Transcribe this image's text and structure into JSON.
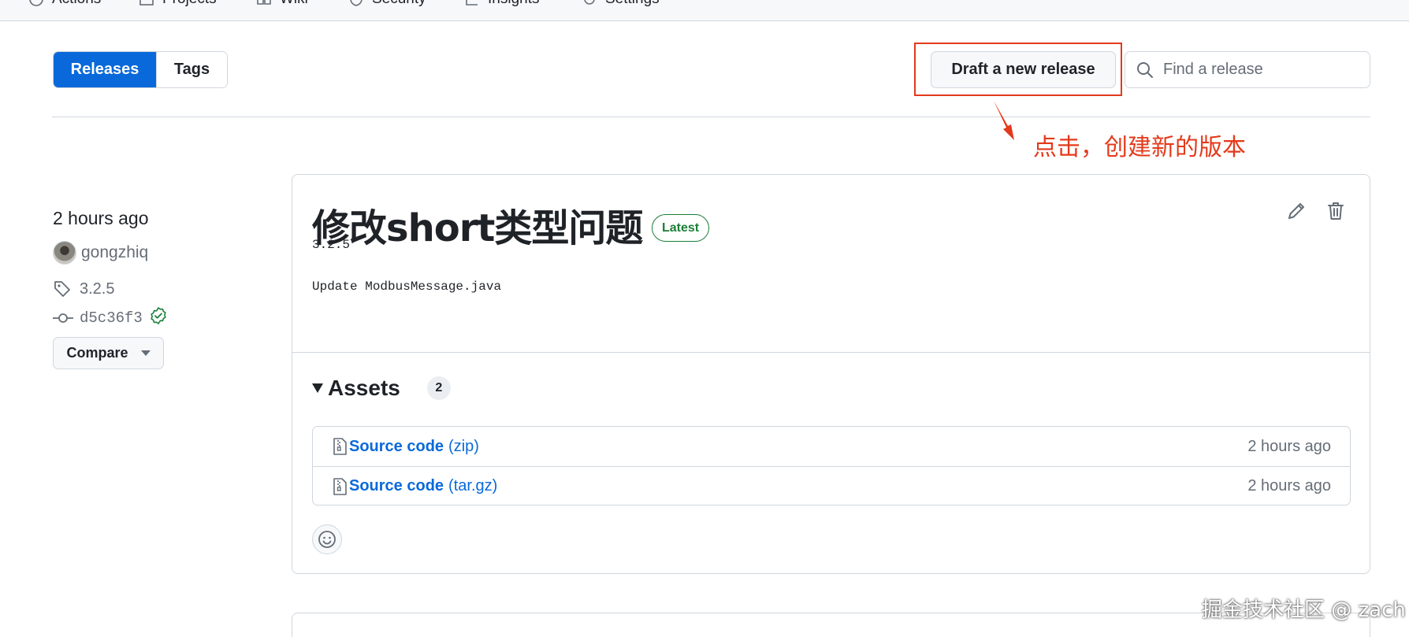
{
  "top_nav": {
    "items": [
      {
        "label": "Actions",
        "icon": "play-icon"
      },
      {
        "label": "Projects",
        "icon": "table-icon"
      },
      {
        "label": "Wiki",
        "icon": "book-icon"
      },
      {
        "label": "Security",
        "icon": "shield-icon"
      },
      {
        "label": "Insights",
        "icon": "graph-icon"
      },
      {
        "label": "Settings",
        "icon": "gear-icon"
      }
    ]
  },
  "toolbar": {
    "releases_label": "Releases",
    "tags_label": "Tags",
    "draft_label": "Draft a new release",
    "search_placeholder": "Find a release"
  },
  "annotation": {
    "text": "点击，创建新的版本",
    "color": "#e4391b"
  },
  "release": {
    "time_ago": "2 hours ago",
    "author": "gongzhiq",
    "tag": "3.2.5",
    "commit": "d5c36f3",
    "compare_label": "Compare",
    "title": "修改short类型问题",
    "badge": "Latest",
    "body_lines": [
      "3.2.5",
      "Update ModbusMessage.java"
    ],
    "assets_label": "Assets",
    "assets_count": "2",
    "assets": [
      {
        "name": "Source code",
        "ext": "(zip)",
        "time": "2 hours ago"
      },
      {
        "name": "Source code",
        "ext": "(tar.gz)",
        "time": "2 hours ago"
      }
    ]
  },
  "colors": {
    "accent": "#0969da",
    "success": "#1a7f37",
    "border": "#d0d7de"
  },
  "watermark": "掘金技术社区 @ zach"
}
